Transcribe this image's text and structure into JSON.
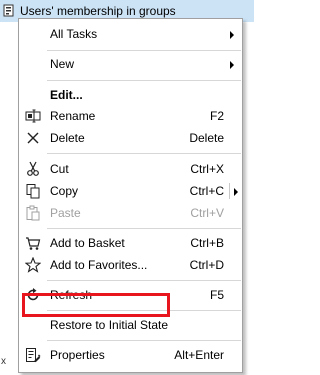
{
  "window": {
    "title": "Users' membership in groups"
  },
  "stray_glyph": "x",
  "menu": {
    "items": [
      {
        "label": "All Tasks",
        "shortcut": "",
        "submenu": true
      },
      {
        "label": "New",
        "shortcut": "",
        "submenu": true
      },
      {
        "label": "Edit...",
        "shortcut": "",
        "bold": true
      },
      {
        "label": "Rename",
        "shortcut": "F2",
        "icon": "rename-icon"
      },
      {
        "label": "Delete",
        "shortcut": "Delete",
        "icon": "delete-x-icon"
      },
      {
        "label": "Cut",
        "shortcut": "Ctrl+X",
        "icon": "scissors-icon"
      },
      {
        "label": "Copy",
        "shortcut": "Ctrl+C",
        "icon": "copy-icon",
        "submenu": true
      },
      {
        "label": "Paste",
        "shortcut": "Ctrl+V",
        "icon": "paste-icon",
        "disabled": true
      },
      {
        "label": "Add to Basket",
        "shortcut": "Ctrl+B",
        "icon": "basket-icon"
      },
      {
        "label": "Add to Favorites...",
        "shortcut": "Ctrl+D",
        "icon": "star-icon"
      },
      {
        "label": "Refresh",
        "shortcut": "F5",
        "icon": "refresh-icon"
      },
      {
        "label": "Restore to Initial State",
        "shortcut": "",
        "highlighted": true
      },
      {
        "label": "Properties",
        "shortcut": "Alt+Enter",
        "icon": "properties-icon"
      }
    ]
  },
  "colors": {
    "titlebar_bg": "#cce3f6",
    "highlight_border": "#e8141e",
    "disabled_text": "#a0a0a0"
  }
}
